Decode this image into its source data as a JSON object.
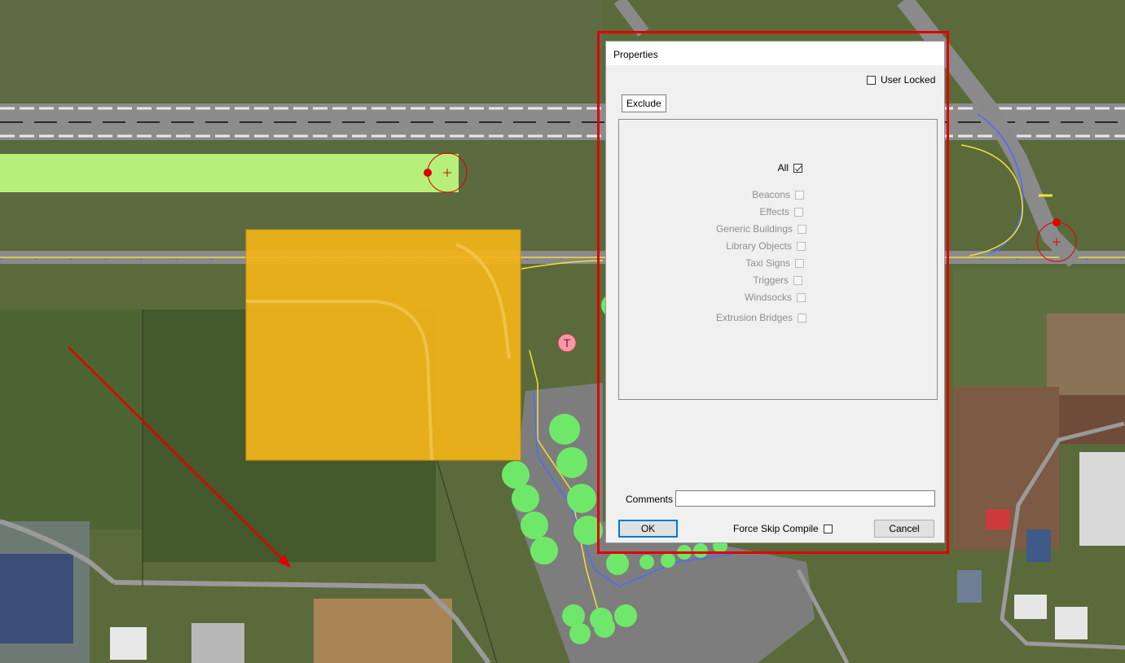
{
  "dialog": {
    "title": "Properties",
    "user_locked": {
      "label": "User Locked",
      "checked": false
    },
    "tab_label": "Exclude",
    "exclude_items": [
      {
        "label": "All",
        "checked": true,
        "enabled": true
      },
      {
        "label": "Beacons",
        "checked": false,
        "enabled": false
      },
      {
        "label": "Effects",
        "checked": false,
        "enabled": false
      },
      {
        "label": "Generic Buildings",
        "checked": false,
        "enabled": false
      },
      {
        "label": "Library Objects",
        "checked": false,
        "enabled": false
      },
      {
        "label": "Taxi Signs",
        "checked": false,
        "enabled": false
      },
      {
        "label": "Triggers",
        "checked": false,
        "enabled": false
      },
      {
        "label": "Windsocks",
        "checked": false,
        "enabled": false
      },
      {
        "label": "Extrusion Bridges",
        "checked": false,
        "enabled": false
      }
    ],
    "comments_label": "Comments",
    "comments_value": "",
    "ok_label": "OK",
    "force_skip_compile": {
      "label": "Force Skip Compile",
      "checked": false
    },
    "cancel_label": "Cancel"
  },
  "map": {
    "colors": {
      "field": "#5d6b3c",
      "runway": "#8a8a8a",
      "grass_zone": "#b6f07a",
      "exclusion_zone": "#f2b41a",
      "node_circle": "#6fe86a",
      "highlight": "#e00000"
    },
    "marker_letter": "T"
  }
}
